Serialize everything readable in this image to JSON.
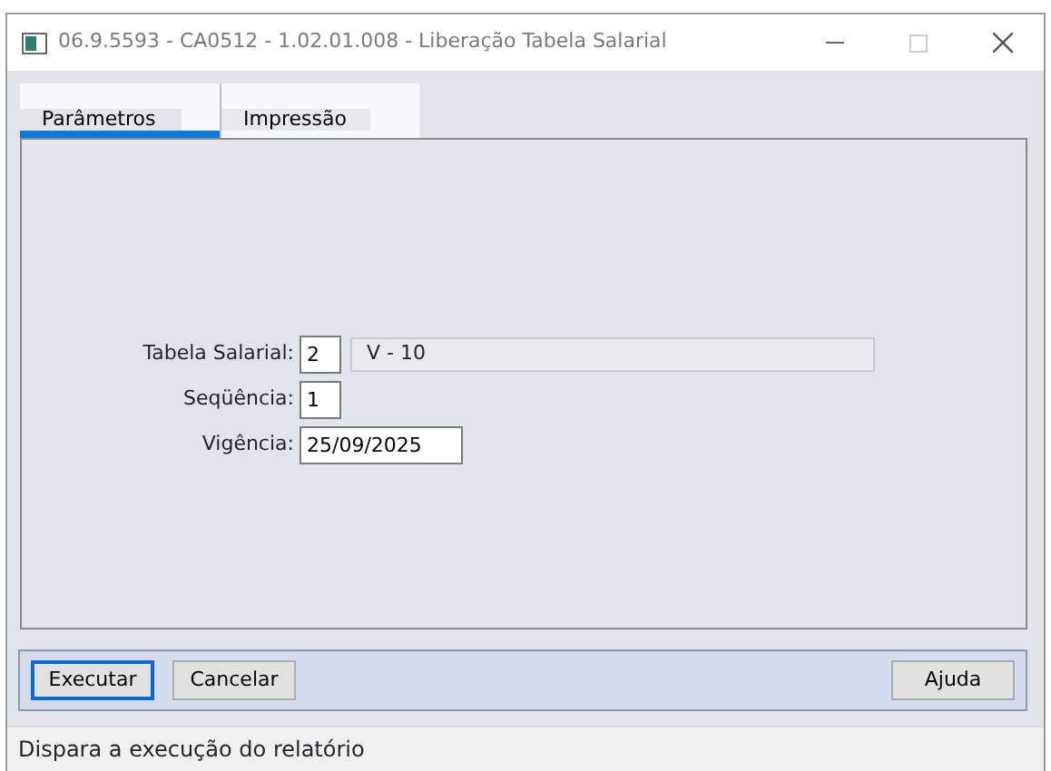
{
  "window": {
    "title": "06.9.5593 - CA0512 - 1.02.01.008 - Liberação Tabela Salarial"
  },
  "tabs": [
    {
      "label": "Parâmetros",
      "selected": true
    },
    {
      "label": "Impressão",
      "selected": false
    }
  ],
  "form": {
    "fields": [
      {
        "label": "Tabela Salarial:",
        "value": "2",
        "description": "V - 10"
      },
      {
        "label": "Seqüência:",
        "value": "1"
      },
      {
        "label": "Vigência:",
        "value": "25/09/2025"
      }
    ]
  },
  "buttons_left": [
    {
      "label": "Executar",
      "focused": true
    },
    {
      "label": "Cancelar",
      "focused": false
    }
  ],
  "buttons_right": [
    {
      "label": "Ajuda",
      "focused": false
    }
  ],
  "status_bar": "Dispara a execução do relatório"
}
